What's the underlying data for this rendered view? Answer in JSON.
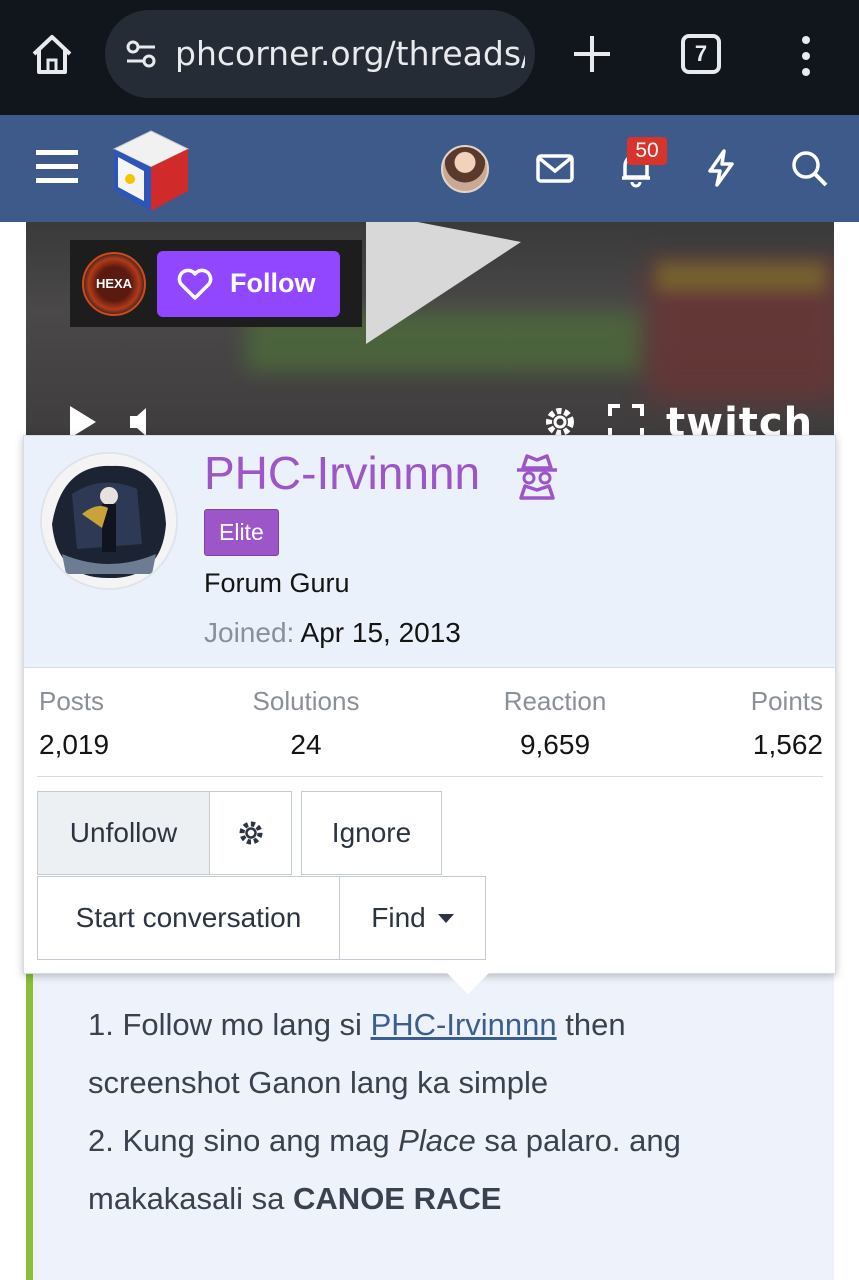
{
  "browser": {
    "url": "phcorner.org/threads/",
    "tab_count": "7",
    "icons": [
      "home-icon",
      "site-settings-icon",
      "new-tab-icon",
      "tab-switcher-icon",
      "more-menu-icon"
    ]
  },
  "site_header": {
    "notification_count": "50",
    "icons": [
      "menu-icon",
      "logo",
      "avatar",
      "mail-icon",
      "bell-icon",
      "lightning-icon",
      "search-icon"
    ]
  },
  "video": {
    "channel_logo_text": "HEXA",
    "follow_label": "Follow",
    "brand": "twitch",
    "twitch_color": "#9147ff"
  },
  "profile_card": {
    "username": "PHC-Irvinnnn",
    "username_color": "#9c56c7",
    "role_badge": "Elite",
    "user_title": "Forum Guru",
    "joined_label": "Joined:",
    "joined_date": "Apr 15, 2013",
    "stats": [
      {
        "label": "Posts",
        "value": "2,019"
      },
      {
        "label": "Solutions",
        "value": "24"
      },
      {
        "label": "Reaction",
        "value": "9,659"
      },
      {
        "label": "Points",
        "value": "1,562"
      }
    ],
    "buttons": {
      "unfollow": "Unfollow",
      "ignore": "Ignore",
      "start_conversation": "Start conversation",
      "find": "Find"
    }
  },
  "post": {
    "line1_a": "1. Follow mo lang si ",
    "line1_link": "PHC-Irvinnnn",
    "line1_b": " then",
    "line2": "screenshot Ganon lang ka simple",
    "line3_a": "2. Kung sino ang mag ",
    "line3_em": "Place",
    "line3_b": " sa palaro. ang",
    "line4_a": "makakasali sa ",
    "line4_bold": "CANOE RACE",
    "accent_color": "#86c135"
  }
}
